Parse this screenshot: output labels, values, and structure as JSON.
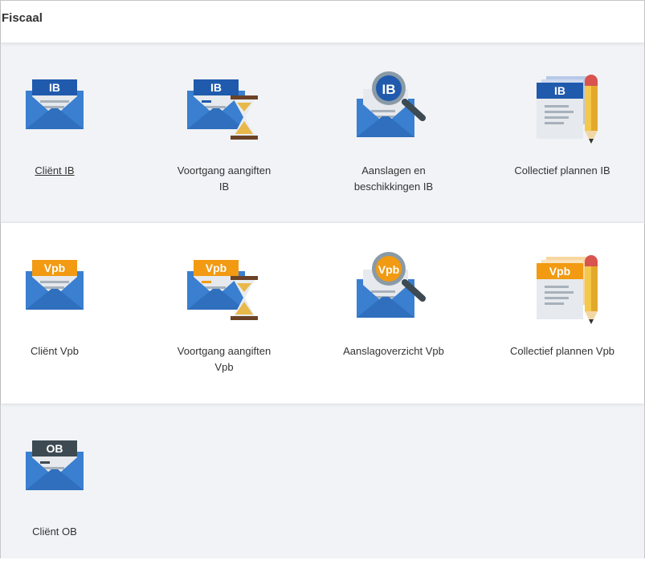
{
  "header": {
    "title": "Fiscaal"
  },
  "colors": {
    "blue": "#1f5aad",
    "envelope": "#3a7fd0",
    "orange": "#f19a12",
    "dark": "#3d4a52"
  },
  "rows": [
    {
      "tiles": [
        {
          "label": "Cliënt IB",
          "badge": "IB",
          "icon": "envelope-ib-icon",
          "linked": true
        },
        {
          "label": "Voortgang aangiften IB",
          "badge": "IB",
          "icon": "envelope-hourglass-ib-icon"
        },
        {
          "label": "Aanslagen en beschikkingen IB",
          "badge": "IB",
          "icon": "envelope-magnifier-ib-icon"
        },
        {
          "label": "Collectief plannen IB",
          "badge": "IB",
          "icon": "documents-pencil-ib-icon"
        }
      ]
    },
    {
      "tiles": [
        {
          "label": "Cliënt Vpb",
          "badge": "Vpb",
          "icon": "envelope-vpb-icon"
        },
        {
          "label": "Voortgang aangiften Vpb",
          "badge": "Vpb",
          "icon": "envelope-hourglass-vpb-icon"
        },
        {
          "label": "Aanslagoverzicht Vpb",
          "badge": "Vpb",
          "icon": "envelope-magnifier-vpb-icon"
        },
        {
          "label": "Collectief plannen Vpb",
          "badge": "Vpb",
          "icon": "documents-pencil-vpb-icon"
        }
      ]
    },
    {
      "tiles": [
        {
          "label": "Cliënt OB",
          "badge": "OB",
          "icon": "envelope-ob-icon"
        }
      ]
    }
  ]
}
